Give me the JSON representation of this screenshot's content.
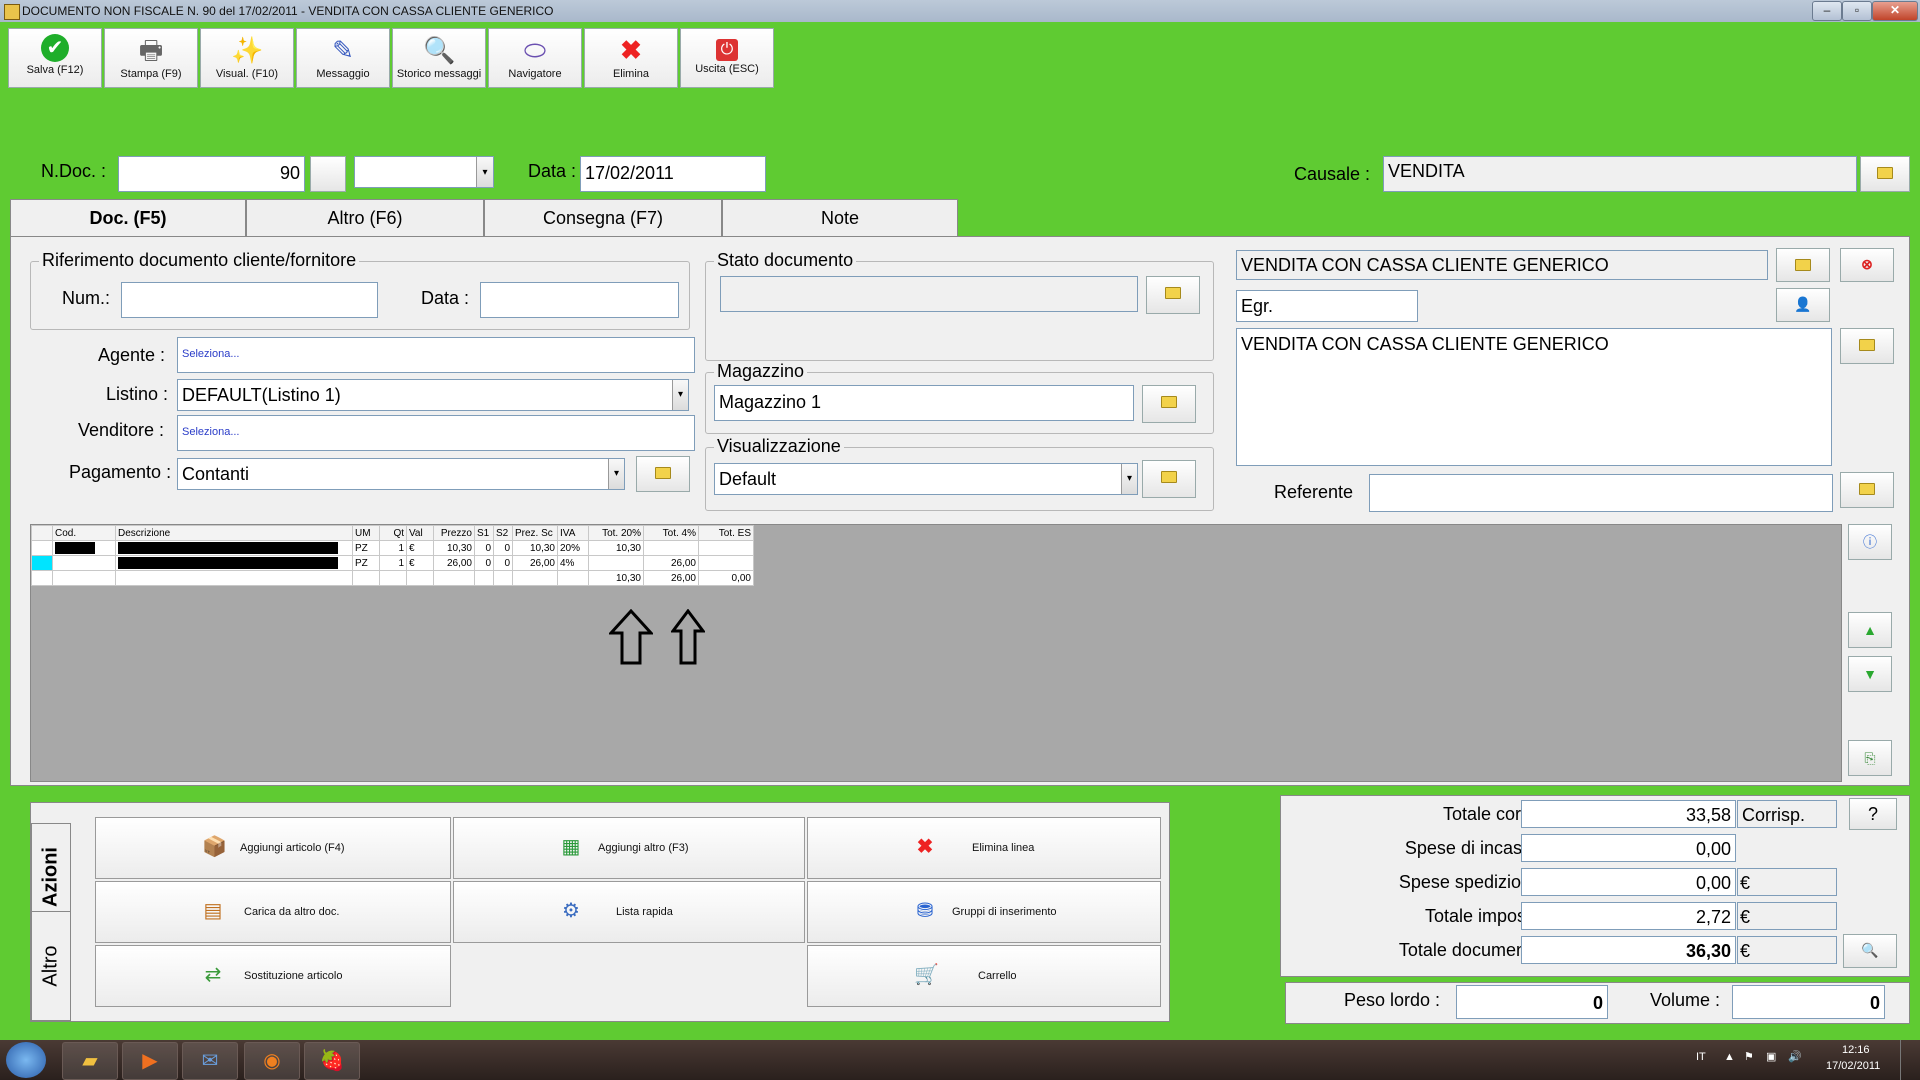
{
  "window": {
    "title": "DOCUMENTO NON FISCALE N. 90  del 17/02/2011 - VENDITA CON CASSA CLIENTE GENERICO"
  },
  "toolbar": {
    "buttons": [
      {
        "label": "Salva (F12)",
        "icon": "check-icon"
      },
      {
        "label": "Stampa (F9)",
        "icon": "printer-icon"
      },
      {
        "label": "Visual. (F10)",
        "icon": "wand-icon"
      },
      {
        "label": "Messaggio",
        "icon": "message-icon"
      },
      {
        "label": "Storico messaggi",
        "icon": "history-icon"
      },
      {
        "label": "Navigatore",
        "icon": "navigator-icon"
      },
      {
        "label": "Elimina",
        "icon": "delete-icon"
      },
      {
        "label": "Uscita (ESC)",
        "icon": "exit-icon"
      }
    ]
  },
  "header": {
    "ndoc_label": "N.Doc. :",
    "ndoc_value": "90",
    "data_label": "Data :",
    "data_value": "17/02/2011",
    "causale_label": "Causale :",
    "causale_value": "VENDITA"
  },
  "tabs": [
    "Doc. (F5)",
    "Altro (F6)",
    "Consegna (F7)",
    "Note"
  ],
  "riferimento": {
    "title": "Riferimento documento cliente/fornitore",
    "num_label": "Num.:",
    "data_label": "Data :"
  },
  "fields": {
    "agente_label": "Agente :",
    "agente_value": "Seleziona...",
    "listino_label": "Listino :",
    "listino_value": "DEFAULT(Listino 1)",
    "venditore_label": "Venditore :",
    "venditore_value": "Seleziona...",
    "pagamento_label": "Pagamento :",
    "pagamento_value": "Contanti"
  },
  "stato": {
    "title": "Stato documento"
  },
  "magazzino": {
    "title": "Magazzino",
    "value": "Magazzino 1"
  },
  "visualizzazione": {
    "title": "Visualizzazione",
    "value": "Default"
  },
  "cliente": {
    "name": "VENDITA CON CASSA CLIENTE GENERICO",
    "salutation": "Egr.",
    "address": "VENDITA CON CASSA CLIENTE GENERICO",
    "referente_label": "Referente"
  },
  "grid": {
    "columns": [
      "Cod.",
      "Descrizione",
      "UM",
      "Qt",
      "Val",
      "Prezzo",
      "S1",
      "S2",
      "Prez. Sc",
      "IVA",
      "Tot. 20%",
      "Tot. 4%",
      "Tot. ES"
    ],
    "rows": [
      {
        "um": "PZ",
        "qt": "1",
        "val": "€",
        "prezzo": "10,30",
        "s1": "0",
        "s2": "0",
        "prezsc": "10,30",
        "iva": "20%",
        "tot20": "10,30",
        "tot4": "",
        "totes": ""
      },
      {
        "um": "PZ",
        "qt": "1",
        "val": "€",
        "prezzo": "26,00",
        "s1": "0",
        "s2": "0",
        "prezsc": "26,00",
        "iva": "4%",
        "tot20": "",
        "tot4": "26,00",
        "totes": ""
      }
    ],
    "totals": {
      "tot20": "10,30",
      "tot4": "26,00",
      "totes": "0,00"
    }
  },
  "actions": {
    "vtab_azioni": "Azioni",
    "vtab_altro": "Altro",
    "buttons": {
      "aggiungi_articolo": "Aggiungi articolo (F4)",
      "aggiungi_altro": "Aggiungi altro (F3)",
      "elimina_linea": "Elimina linea",
      "carica_da_altro": "Carica da altro doc.",
      "lista_rapida": "Lista rapida",
      "gruppi_inserimento": "Gruppi di inserimento",
      "sostituzione_articolo": "Sostituzione articolo",
      "carrello": "Carrello"
    }
  },
  "totals": {
    "totale_corpo_label": "Totale corpo :",
    "totale_corpo_value": "33,58",
    "corrisp_label": "Corrisp.",
    "help_label": "?",
    "spese_incasso_label": "Spese di incasso :",
    "spese_incasso_value": "0,00",
    "spese_spedizione_label": "Spese spedizione :",
    "spese_spedizione_value": "0,00",
    "totale_imposte_label": "Totale imposte :",
    "totale_imposte_value": "2,72",
    "totale_documento_label": "Totale documento :",
    "totale_documento_value": "36,30",
    "currency": "€"
  },
  "weights": {
    "peso_label": "Peso lordo :",
    "peso_value": "0",
    "volume_label": "Volume :",
    "volume_value": "0"
  },
  "taskbar": {
    "lang": "IT",
    "time": "12:16",
    "date": "17/02/2011"
  }
}
